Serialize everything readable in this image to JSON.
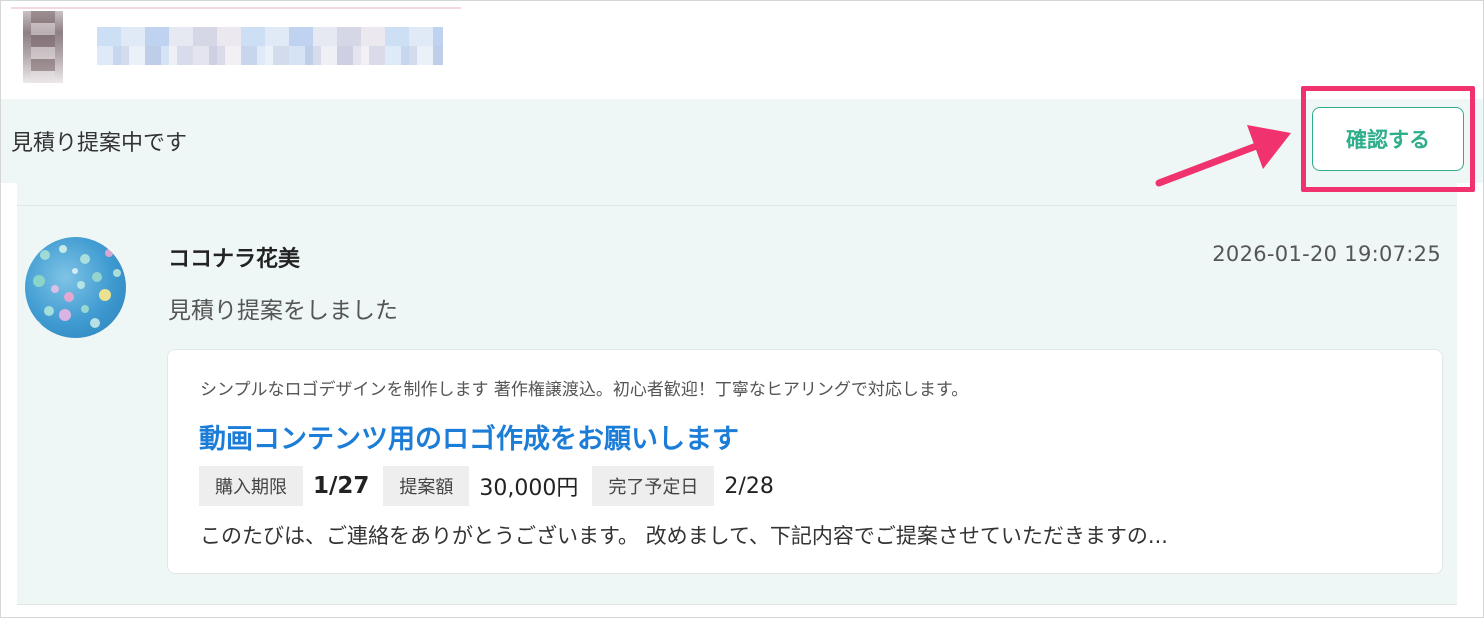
{
  "status": {
    "text": "見積り提案中です",
    "confirm_label": "確認する"
  },
  "message": {
    "sender": "ココナラ花美",
    "timestamp": "2026-01-20 19:07:25",
    "text": "見積り提案をしました"
  },
  "proposal": {
    "service_title": "シンプルなロゴデザインを制作します 著作権譲渡込。初心者歓迎！丁寧なヒアリングで対応します。",
    "request_title": "動画コンテンツ用のロゴ作成をお願いします",
    "purchase_deadline_label": "購入期限",
    "purchase_deadline": "1/27",
    "amount_label": "提案額",
    "amount": "30,000円",
    "completion_label": "完了予定日",
    "completion_date": "2/28",
    "excerpt": "このたびは、ご連絡をありがとうございます。 改めまして、下記内容でご提案させていただきますの..."
  },
  "colors": {
    "accent": "#2fae8c",
    "link": "#1b7dd8",
    "highlight": "#f0326f",
    "panel_bg": "#eef7f6"
  },
  "icons": {
    "annotation_arrow": "arrow-icon"
  }
}
